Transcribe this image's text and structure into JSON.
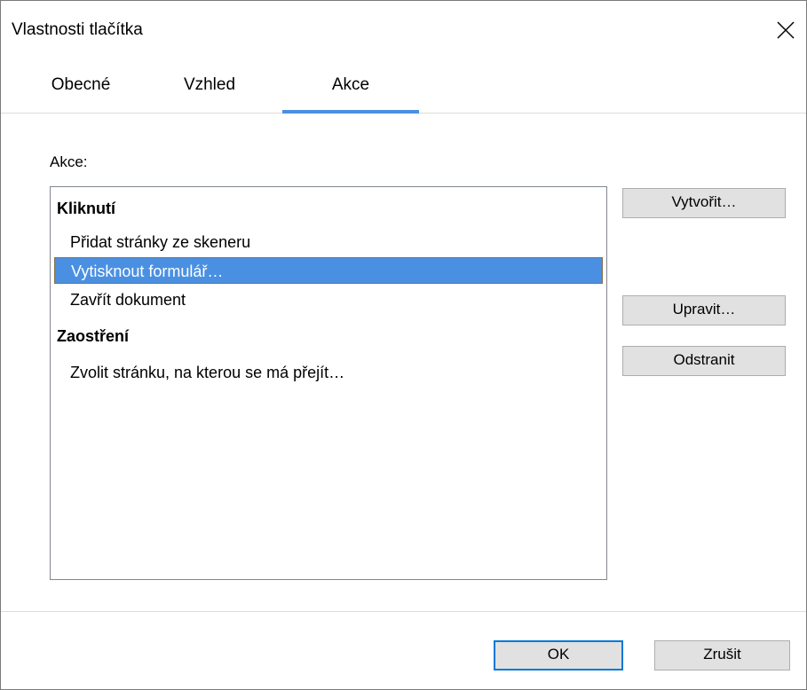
{
  "window": {
    "title": "Vlastnosti tlačítka",
    "close_icon": "close-icon"
  },
  "tabs": [
    {
      "label": "Obecné",
      "active": false
    },
    {
      "label": "Vzhled",
      "active": false
    },
    {
      "label": "Akce",
      "active": true
    }
  ],
  "actions": {
    "label": "Akce:",
    "groups": [
      {
        "header": "Kliknutí",
        "items": [
          {
            "label": "Přidat stránky ze skeneru",
            "selected": false
          },
          {
            "label": "Vytisknout formulář…",
            "selected": true
          },
          {
            "label": "Zavřít dokument",
            "selected": false
          }
        ]
      },
      {
        "header": "Zaostření",
        "items": [
          {
            "label": "Zvolit stránku, na kterou se má přejít…",
            "selected": false
          }
        ]
      }
    ]
  },
  "side_buttons": {
    "create": "Vytvořit…",
    "edit": "Upravit…",
    "delete": "Odstranit"
  },
  "footer": {
    "ok": "OK",
    "cancel": "Zrušit"
  },
  "colors": {
    "accent": "#4a90e2",
    "selection": "#4a90e2",
    "button_bg": "#e1e1e1",
    "default_button_border": "#0078d7"
  }
}
